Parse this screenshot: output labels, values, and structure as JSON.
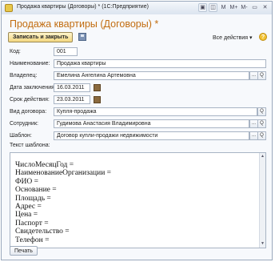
{
  "window": {
    "title": "Продажа квартиры (Договоры) * (1С:Предприятие)",
    "controls": [
      "▣",
      "◫",
      "M",
      "M+",
      "M-",
      "▭",
      "✕"
    ]
  },
  "form": {
    "title": "Продажа квартиры (Договоры) *",
    "save_close_label": "Записать и закрыть",
    "all_actions_label": "Все действия ▾",
    "help_label": "?"
  },
  "fields": {
    "code": {
      "label": "Код:",
      "value": "001"
    },
    "name": {
      "label": "Наименование:",
      "value": "Продажа квартиры"
    },
    "owner": {
      "label": "Владелец:",
      "value": "Емелина Ангелина Артемовна"
    },
    "date_concluded": {
      "label": "Дата заключения:",
      "value": "16.03.2011"
    },
    "term": {
      "label": "Срок действия:",
      "value": "23.03.2011"
    },
    "contract_type": {
      "label": "Вид договора:",
      "value": "Купля-продажа"
    },
    "employee": {
      "label": "Сотрудник:",
      "value": "Гудимова Анастасия Владимировна"
    },
    "template": {
      "label": "Шаблон:",
      "value": "Договор купли-продажи недвижимости"
    },
    "template_text_label": "Текст шаблона:"
  },
  "template_text": [
    "ЧислоМесяцГод =",
    "НаименованиеОрганизации =",
    "ФИО =",
    "Основание =",
    "Площадь =",
    "Адрес =",
    "Цена =",
    "Паспорт =",
    "Свидетельство =",
    "Телефон ="
  ],
  "picker_buttons": {
    "ellipsis": "...",
    "open": "Q"
  },
  "print_label": "Печать"
}
